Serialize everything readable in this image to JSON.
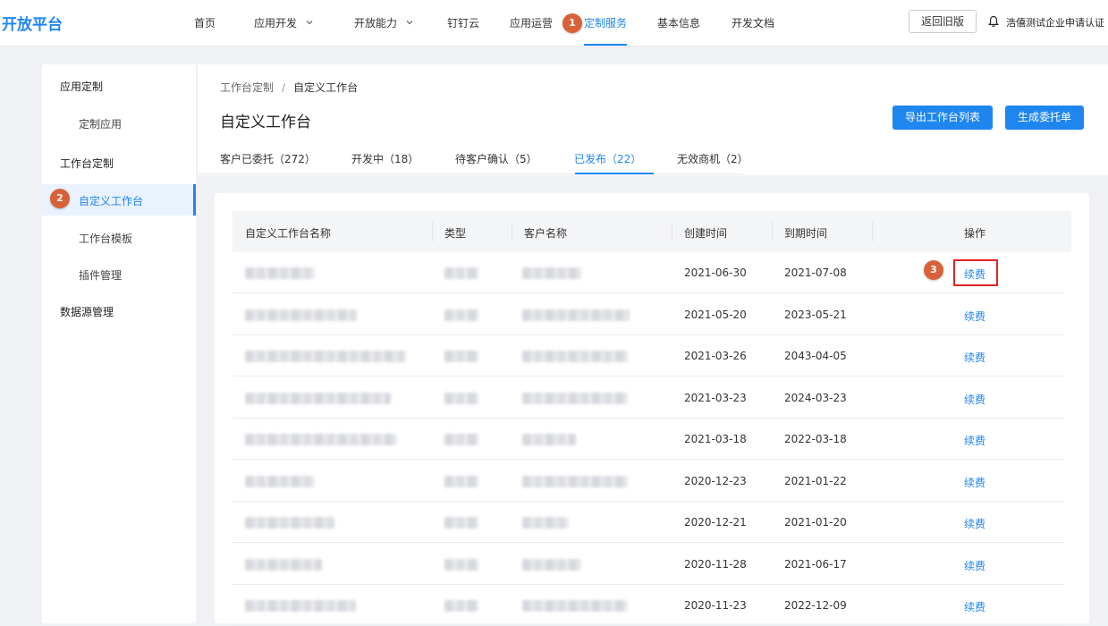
{
  "brand": "开放平台",
  "nav": {
    "items": [
      {
        "label": "首页",
        "dropdown": false
      },
      {
        "label": "应用开发",
        "dropdown": true
      },
      {
        "label": "开放能力",
        "dropdown": true
      },
      {
        "label": "钉钉云",
        "dropdown": false
      },
      {
        "label": "应用运营",
        "dropdown": false
      },
      {
        "label": "定制服务",
        "dropdown": false,
        "active": true
      },
      {
        "label": "基本信息",
        "dropdown": false
      },
      {
        "label": "开发文档",
        "dropdown": false
      }
    ],
    "old_version_label": "返回旧版",
    "company": "浩僖测试企业申请认证"
  },
  "steps": [
    "1",
    "2",
    "3"
  ],
  "sidebar": {
    "groups": [
      {
        "label": "应用定制",
        "children": [
          "定制应用"
        ]
      },
      {
        "label": "工作台定制",
        "children": [
          "自定义工作台",
          "工作台模板",
          "插件管理"
        ]
      },
      {
        "label": "数据源管理",
        "children": []
      }
    ],
    "active_item": "自定义工作台"
  },
  "main": {
    "breadcrumb": [
      "工作台定制",
      "自定义工作台"
    ],
    "breadcrumb_sep": "/",
    "title": "自定义工作台",
    "buttons": {
      "export": "导出工作台列表",
      "create": "生成委托单"
    },
    "tabs": [
      {
        "label": "客户已委托（272）"
      },
      {
        "label": "开发中（18）"
      },
      {
        "label": "待客户确认（5）"
      },
      {
        "label": "已发布（22）",
        "active": true
      },
      {
        "label": "无效商机（2）"
      }
    ]
  },
  "table": {
    "columns": [
      "自定义工作台名称",
      "类型",
      "客户名称",
      "创建时间",
      "到期时间",
      "操作"
    ],
    "action_label": "续费",
    "rows": [
      {
        "created": "2021-06-30",
        "expires": "2021-07-08"
      },
      {
        "created": "2021-05-20",
        "expires": "2023-05-21"
      },
      {
        "created": "2021-03-26",
        "expires": "2043-04-05"
      },
      {
        "created": "2021-03-23",
        "expires": "2024-03-23"
      },
      {
        "created": "2021-03-18",
        "expires": "2022-03-18"
      },
      {
        "created": "2020-12-23",
        "expires": "2021-01-22"
      },
      {
        "created": "2020-12-21",
        "expires": "2021-01-20"
      },
      {
        "created": "2020-11-28",
        "expires": "2021-06-17"
      },
      {
        "created": "2020-11-23",
        "expires": "2022-12-09"
      }
    ]
  },
  "colors": {
    "accent": "#1f86f0",
    "badge": "#d9613a",
    "highlight": "#e02424"
  }
}
